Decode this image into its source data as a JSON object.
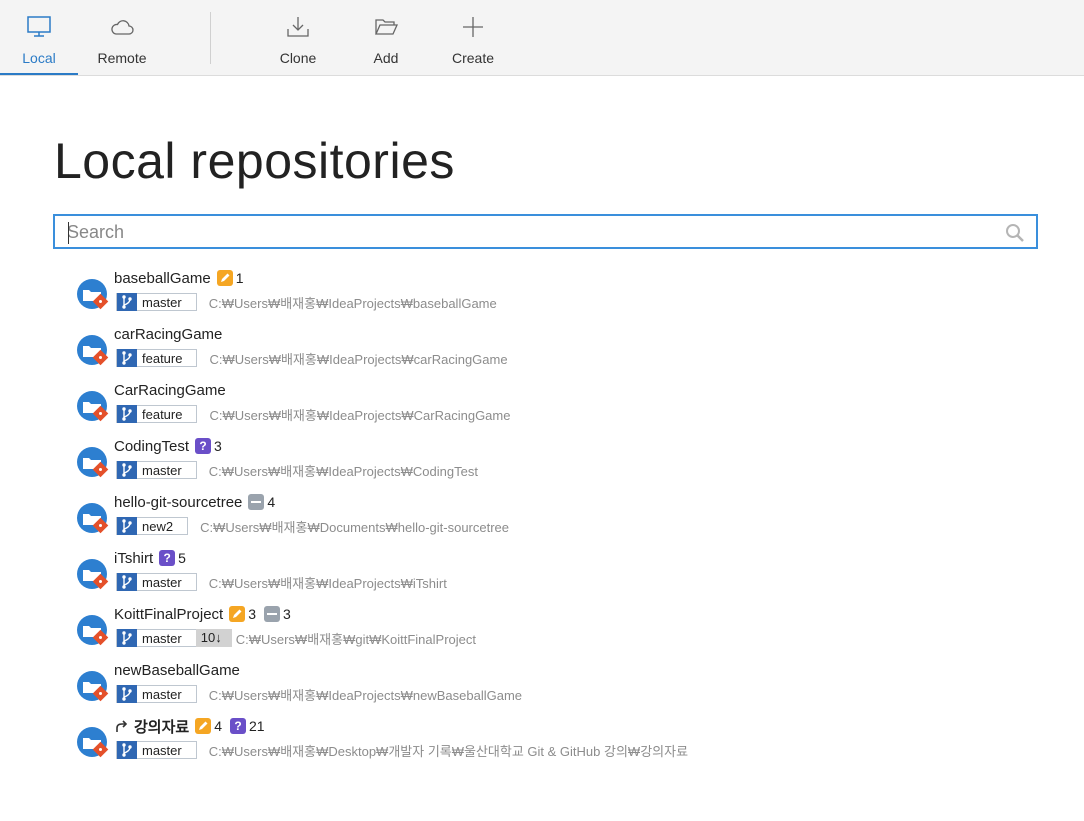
{
  "toolbar": {
    "local": "Local",
    "remote": "Remote",
    "clone": "Clone",
    "add": "Add",
    "create": "Create"
  },
  "page_title": "Local repositories",
  "search": {
    "placeholder": "Search"
  },
  "colors": {
    "accent": "#2b7bc6",
    "modified": "#f5a623",
    "untracked": "#6a4fc8",
    "removed": "#9aa3ad",
    "branch": "#2f67b3"
  },
  "repositories": [
    {
      "name": "baseballGame",
      "badges": [
        {
          "type": "modified",
          "count": "1"
        }
      ],
      "branch": "master",
      "behind": "",
      "path": "C:₩Users₩배재홍₩IdeaProjects₩baseballGame"
    },
    {
      "name": "carRacingGame",
      "badges": [],
      "branch": "feature",
      "behind": "",
      "path": "C:₩Users₩배재홍₩IdeaProjects₩carRacingGame"
    },
    {
      "name": "CarRacingGame",
      "badges": [],
      "branch": "feature",
      "behind": "",
      "path": "C:₩Users₩배재홍₩IdeaProjects₩CarRacingGame"
    },
    {
      "name": "CodingTest",
      "badges": [
        {
          "type": "untracked",
          "count": "3"
        }
      ],
      "branch": "master",
      "behind": "",
      "path": "C:₩Users₩배재홍₩IdeaProjects₩CodingTest"
    },
    {
      "name": "hello-git-sourcetree",
      "badges": [
        {
          "type": "removed",
          "count": "4"
        }
      ],
      "branch": "new2",
      "behind": "",
      "path": "C:₩Users₩배재홍₩Documents₩hello-git-sourcetree"
    },
    {
      "name": "iTshirt",
      "badges": [
        {
          "type": "untracked",
          "count": "5"
        }
      ],
      "branch": "master",
      "behind": "",
      "path": "C:₩Users₩배재홍₩IdeaProjects₩iTshirt"
    },
    {
      "name": "KoittFinalProject",
      "badges": [
        {
          "type": "modified",
          "count": "3"
        },
        {
          "type": "removed",
          "count": "3"
        }
      ],
      "branch": "master",
      "behind": "10↓",
      "path": "C:₩Users₩배재홍₩git₩KoittFinalProject"
    },
    {
      "name": "newBaseballGame",
      "badges": [],
      "branch": "master",
      "behind": "",
      "path": "C:₩Users₩배재홍₩IdeaProjects₩newBaseballGame"
    },
    {
      "name": "강의자료",
      "shortcut": true,
      "badges": [
        {
          "type": "modified",
          "count": "4"
        },
        {
          "type": "untracked",
          "count": "21"
        }
      ],
      "branch": "master",
      "behind": "",
      "path": "C:₩Users₩배재홍₩Desktop₩개발자 기록₩울산대학교 Git & GitHub 강의₩강의자료"
    }
  ]
}
